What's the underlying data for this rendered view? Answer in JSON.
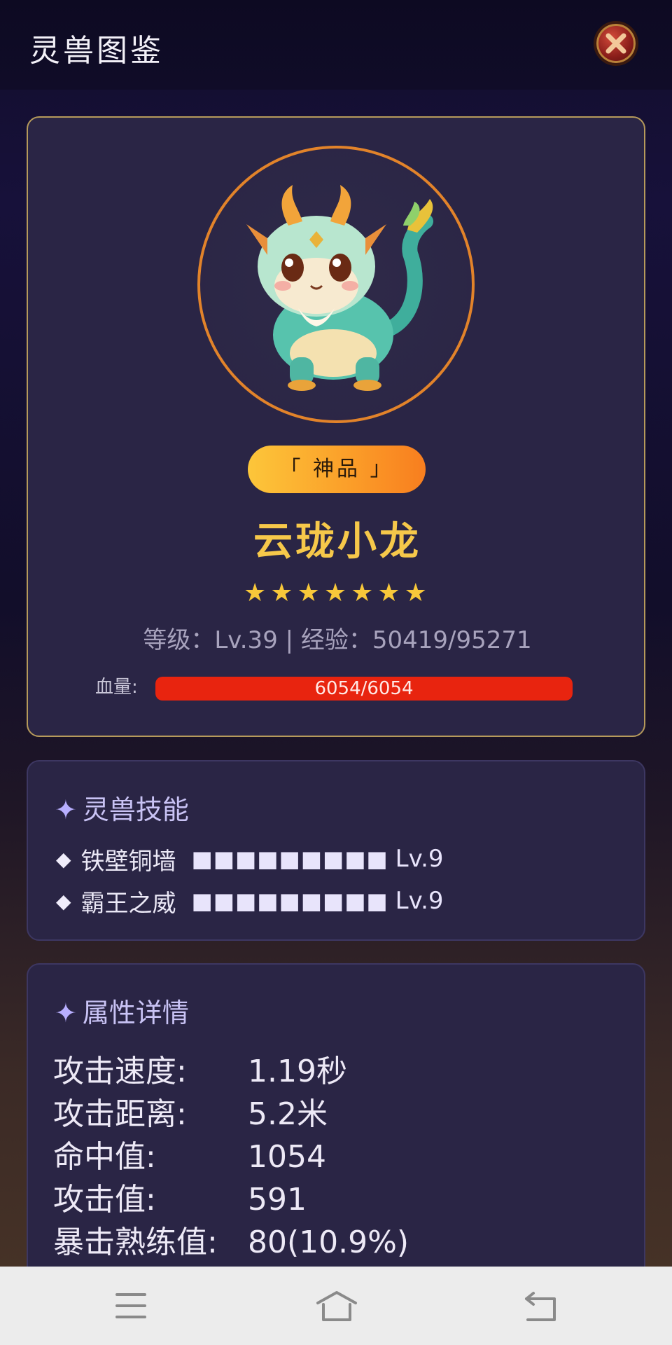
{
  "header": {
    "title": "灵兽图鉴",
    "close_icon": "close-icon"
  },
  "beast": {
    "portrait_icon": "dragon-portrait-icon",
    "rarity": "「 神品 」",
    "name": "云珑小龙",
    "stars": "★★★★★★★",
    "star_count": 7,
    "level_line": "等级：Lv.39 | 经验：50419/95271",
    "hp_label": "血量:",
    "hp_text": "6054/6054",
    "hp_fraction": 1.0
  },
  "skills": {
    "title": "灵兽技能",
    "items": [
      {
        "bullet": "◆",
        "name": "铁壁铜墙",
        "blocks": "■■■■■■■■■",
        "level": "Lv.9"
      },
      {
        "bullet": "◆",
        "name": "霸王之威",
        "blocks": "■■■■■■■■■",
        "level": "Lv.9"
      }
    ]
  },
  "attributes": {
    "title": "属性详情",
    "items": [
      {
        "key": "攻击速度:",
        "value": "1.19秒"
      },
      {
        "key": "攻击距离:",
        "value": "5.2米"
      },
      {
        "key": "命中值:",
        "value": "1054"
      },
      {
        "key": "攻击值:",
        "value": "591"
      },
      {
        "key": "暴击熟练值:",
        "value": "80(10.9%)"
      }
    ]
  },
  "navbar": {
    "menu_icon": "menu-icon",
    "home_icon": "home-icon",
    "back_icon": "back-icon"
  },
  "colors": {
    "accent_gold": "#f6c84a",
    "hp_red": "#e8240f",
    "card_bg": "#2a2545",
    "card_border": "#b69a5b"
  }
}
